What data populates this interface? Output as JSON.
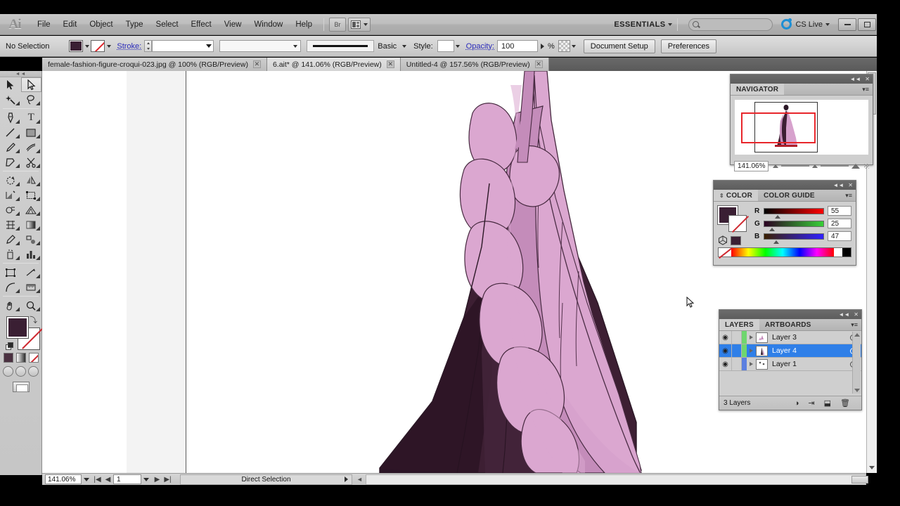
{
  "app": {
    "name": "Adobe Illustrator",
    "logo": "Ai"
  },
  "menubar": {
    "items": [
      "File",
      "Edit",
      "Object",
      "Type",
      "Select",
      "Effect",
      "View",
      "Window",
      "Help"
    ],
    "bridge_label": "Br",
    "workspace": "ESSENTIALS",
    "search_placeholder": "",
    "cs_live": "CS Live",
    "window_buttons": [
      "minimize",
      "maximize",
      "close"
    ],
    "close_glyph": "✕"
  },
  "controlbar": {
    "selection_state": "No Selection",
    "fill_color": "#3a1f33",
    "stroke_color": "none",
    "stroke_label": "Stroke:",
    "stroke_weight": "",
    "stroke_profile": "",
    "brush_name": "Basic",
    "style_label": "Style:",
    "opacity_label": "Opacity:",
    "opacity_value": "100",
    "percent_sign": "%",
    "document_setup": "Document Setup",
    "preferences": "Preferences"
  },
  "tabs": [
    {
      "title": "female-fashion-figure-croqui-023.jpg @ 100% (RGB/Preview)",
      "active": false,
      "close": "✕"
    },
    {
      "title": "6.ait* @ 141.06% (RGB/Preview)",
      "active": true,
      "close": "✕"
    },
    {
      "title": "Untitled-4 @ 157.56% (RGB/Preview)",
      "active": false,
      "close": "✕"
    }
  ],
  "toolbar": {
    "tools": [
      "selection-tool",
      "direct-selection-tool",
      "magic-wand-tool",
      "lasso-tool",
      "pen-tool",
      "type-tool",
      "line-segment-tool",
      "rectangle-tool",
      "paintbrush-tool",
      "blob-brush-tool",
      "pencil-tool",
      "scissors-tool",
      "rotate-tool",
      "reflect-tool",
      "scale-tool",
      "free-transform-tool",
      "shape-builder-tool",
      "perspective-grid-tool",
      "mesh-tool",
      "gradient-tool",
      "eyedropper-tool",
      "blend-tool",
      "symbol-sprayer-tool",
      "column-graph-tool",
      "artboard-tool",
      "slice-tool",
      "arc-tool",
      "measure-tool",
      "hand-tool",
      "zoom-tool"
    ],
    "active_tool": "direct-selection-tool",
    "fill_color": "#3a1f33",
    "stroke_color": "#ffffff",
    "draw_modes": [
      "draw-normal",
      "draw-behind",
      "draw-inside"
    ],
    "color_modes": [
      "color",
      "gradient",
      "none"
    ]
  },
  "navigator": {
    "title": "NAVIGATOR",
    "zoom_value": "141.06%",
    "view_box_color": "#e8262b"
  },
  "color_panel": {
    "tab_color": "COLOR",
    "tab_guide": "COLOR GUIDE",
    "fill_color": "#3a1f33",
    "channels": [
      {
        "label": "R",
        "value": "55"
      },
      {
        "label": "G",
        "value": "25"
      },
      {
        "label": "B",
        "value": "47"
      }
    ]
  },
  "layers_panel": {
    "tab_layers": "LAYERS",
    "tab_artboards": "ARTBOARDS",
    "rows": [
      {
        "name": "Layer 3",
        "visible": true,
        "selected": false,
        "color": "#6fd66f"
      },
      {
        "name": "Layer 4",
        "visible": true,
        "selected": true,
        "color": "#6fd66f"
      },
      {
        "name": "Layer 1",
        "visible": true,
        "selected": false,
        "color": "#5b7fe0"
      }
    ],
    "count_label": "3 Layers",
    "eye_glyph": "◉"
  },
  "statusbar": {
    "zoom": "141.06%",
    "page": "1",
    "tool_status": "Direct Selection"
  },
  "artwork": {
    "description": "Fashion illustration of a long evening gown with a light pink ruffled overlay and dark plum skirt",
    "colors": {
      "pink_light": "#dba7d0",
      "pink_base": "#d7a2cd",
      "pink_mid": "#c48cba",
      "plum_dark": "#3d1f33",
      "plum_shade": "#53304a",
      "plum_deep": "#2e1526",
      "outline": "#2b1826"
    }
  },
  "chart_data": null
}
